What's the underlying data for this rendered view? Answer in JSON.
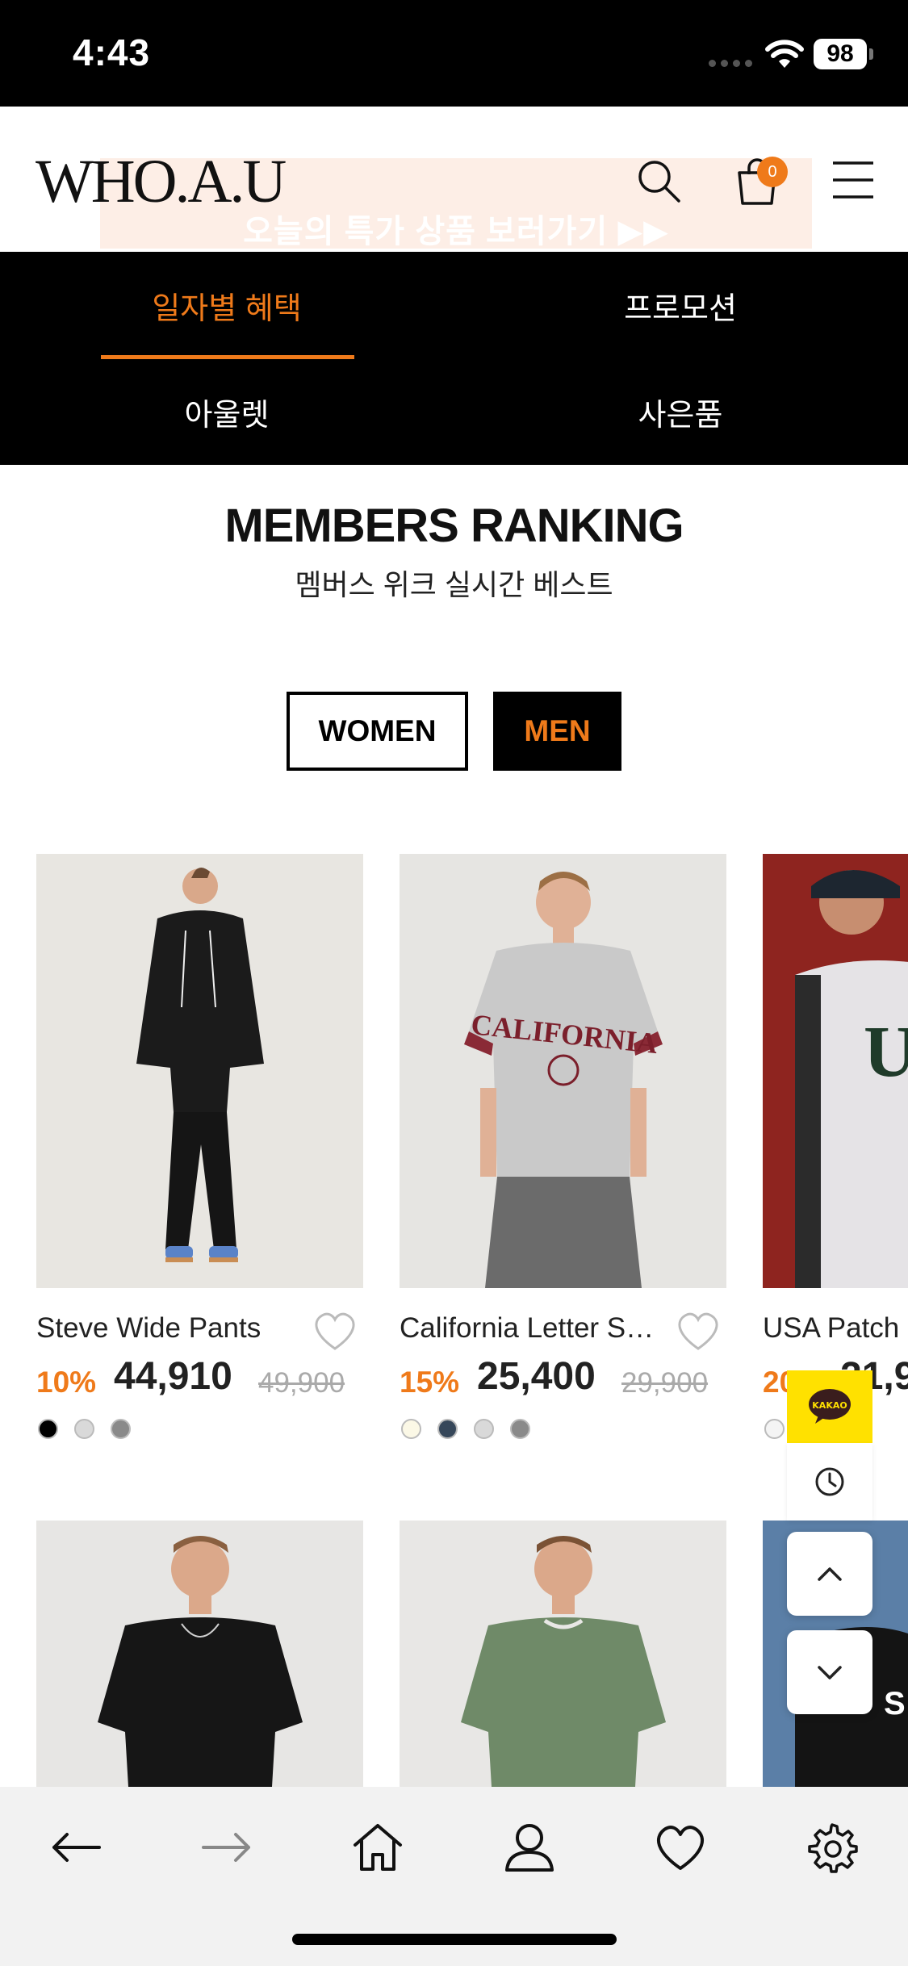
{
  "status_bar": {
    "time": "4:43",
    "battery": "98"
  },
  "header": {
    "logo": "WHO.A.U",
    "promo_text": "오늘의 특가 상품 보러가기 ▶▶",
    "cart_count": "0"
  },
  "category_tabs": [
    {
      "label": "일자별 혜택",
      "active": true
    },
    {
      "label": "프로모션",
      "active": false
    },
    {
      "label": "아울렛",
      "active": false
    },
    {
      "label": "사은품",
      "active": false
    }
  ],
  "ranking": {
    "title": "MEMBERS RANKING",
    "subtitle": "멤버스 위크 실시간 베스트",
    "gender_tabs": [
      {
        "label": "WOMEN",
        "active": false
      },
      {
        "label": "MEN",
        "active": true
      }
    ]
  },
  "products": [
    {
      "name": "Steve Wide Pants",
      "discount": "10%",
      "price": "44,910",
      "original_price": "49,900",
      "swatches": [
        "#000000",
        "#d9d9d9",
        "#8a8a8a"
      ]
    },
    {
      "name": "California Letter S…",
      "discount": "15%",
      "price": "25,400",
      "original_price": "29,900",
      "swatches": [
        "#fbf8e6",
        "#36475a",
        "#d9d9d9",
        "#8a8a8a"
      ]
    },
    {
      "name": "USA Patch",
      "discount": "20",
      "price": "21,9",
      "original_price": "",
      "swatches": [
        "#f4f4f4"
      ]
    }
  ],
  "floating": {
    "kakao_label": "KAKAO"
  },
  "colors": {
    "accent": "#ef7a1a",
    "nav_bg": "#000000",
    "kakao": "#ffe100"
  },
  "icons": {
    "search": "search-icon",
    "cart": "shopping-bag-icon",
    "menu": "hamburger-menu-icon",
    "wishlist": "heart-outline-icon",
    "recent": "clock-icon",
    "scroll_up": "chevron-up-icon",
    "scroll_down": "chevron-down-icon",
    "back": "arrow-left-icon",
    "forward": "arrow-right-icon",
    "home": "home-icon",
    "my_page": "user-icon",
    "likes": "heart-icon",
    "settings": "gear-icon"
  }
}
